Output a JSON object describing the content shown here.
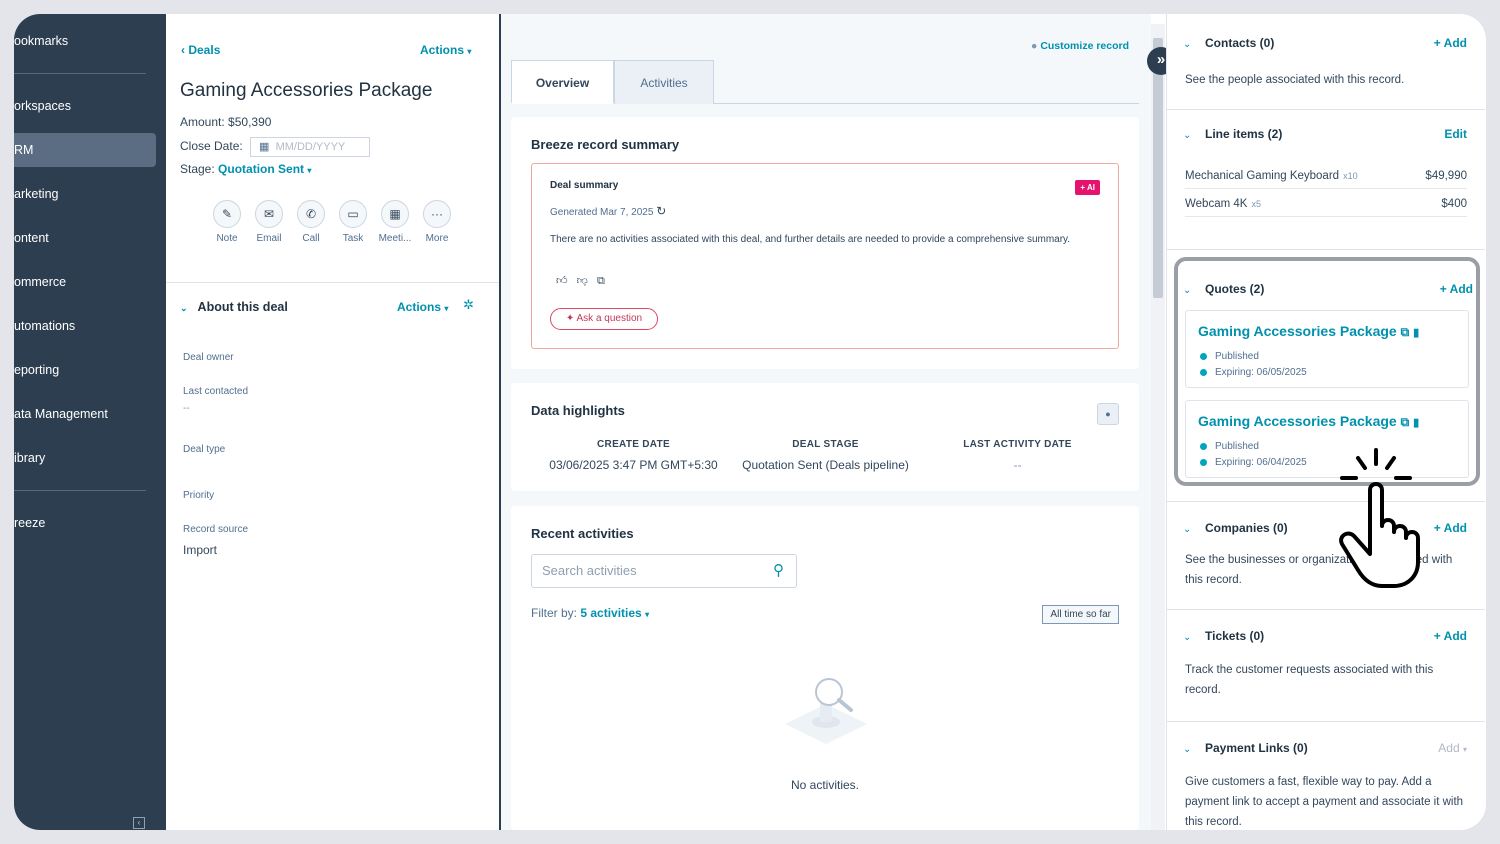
{
  "nav": {
    "items": [
      "ookmarks",
      "orkspaces",
      "RM",
      "arketing",
      "ontent",
      "ommerce",
      "utomations",
      "eporting",
      "ata Management",
      "ibrary",
      "reeze"
    ],
    "active_index": 2
  },
  "record": {
    "back": "Deals",
    "actions": "Actions",
    "title": "Gaming Accessories Package",
    "amount_label": "Amount:",
    "amount": "$50,390",
    "close_date_label": "Close Date:",
    "close_date_placeholder": "MM/DD/YYYY",
    "stage_label": "Stage:",
    "stage": "Quotation Sent",
    "quick_actions": [
      {
        "label": "Note",
        "icon": "note-icon"
      },
      {
        "label": "Email",
        "icon": "email-icon"
      },
      {
        "label": "Call",
        "icon": "call-icon"
      },
      {
        "label": "Task",
        "icon": "task-icon"
      },
      {
        "label": "Meeti...",
        "icon": "meeting-icon"
      },
      {
        "label": "More",
        "icon": "more-icon"
      }
    ],
    "about_title": "About this deal",
    "about_actions": "Actions",
    "properties": [
      {
        "label": "Deal owner",
        "value": ""
      },
      {
        "label": "Last contacted",
        "value": "--"
      },
      {
        "label": "Deal type",
        "value": ""
      },
      {
        "label": "Priority",
        "value": ""
      },
      {
        "label": "Record source",
        "value": "Import"
      }
    ]
  },
  "middle": {
    "customize": "Customize record",
    "tabs": [
      "Overview",
      "Activities"
    ],
    "summary": {
      "title": "Breeze record summary",
      "box_title": "Deal summary",
      "generated": "Generated Mar 7, 2025",
      "ai_badge": "+ AI",
      "text": "There are no activities associated with this deal, and further details are needed to provide a comprehensive summary.",
      "ask": "Ask a question"
    },
    "highlights": {
      "title": "Data highlights",
      "columns": [
        {
          "header": "CREATE DATE",
          "value": "03/06/2025 3:47 PM GMT+5:30"
        },
        {
          "header": "DEAL STAGE",
          "value": "Quotation Sent (Deals pipeline)"
        },
        {
          "header": "LAST ACTIVITY DATE",
          "value": "--"
        }
      ]
    },
    "activities": {
      "title": "Recent activities",
      "search_placeholder": "Search activities",
      "filter_label": "Filter by:",
      "filter_value": "5 activities",
      "time_button": "All time so far",
      "empty": "No activities."
    }
  },
  "sidebar": {
    "contacts": {
      "title": "Contacts (0)",
      "action": "+ Add",
      "text": "See the people associated with this record."
    },
    "line_items": {
      "title": "Line items (2)",
      "action": "Edit",
      "items": [
        {
          "name": "Mechanical Gaming Keyboard",
          "qty": "x10",
          "price": "$49,990"
        },
        {
          "name": "Webcam 4K",
          "qty": "x5",
          "price": "$400"
        }
      ]
    },
    "quotes": {
      "title": "Quotes (2)",
      "action": "+ Add",
      "items": [
        {
          "name": "Gaming Accessories Package",
          "status": "Published",
          "expiry": "Expiring: 06/05/2025"
        },
        {
          "name": "Gaming Accessories Package",
          "status": "Published",
          "expiry": "Expiring: 06/04/2025"
        }
      ]
    },
    "companies": {
      "title": "Companies (0)",
      "action": "+ Add",
      "text": "See the businesses or organizations associated with this record."
    },
    "tickets": {
      "title": "Tickets (0)",
      "action": "+ Add",
      "text": "Track the customer requests associated with this record."
    },
    "payment_links": {
      "title": "Payment Links (0)",
      "action": "Add",
      "text": "Give customers a fast, flexible way to pay. Add a payment link to accept a payment and associate it with this record."
    }
  }
}
